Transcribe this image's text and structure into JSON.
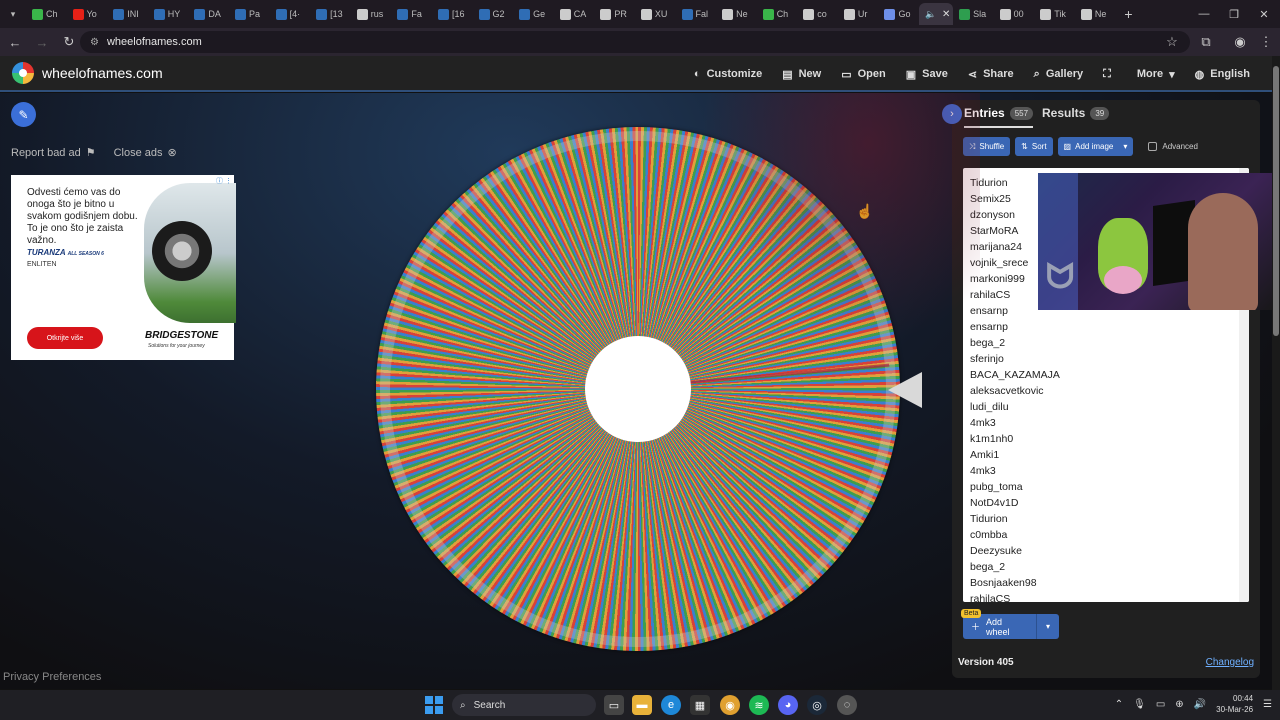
{
  "browser": {
    "tabs": [
      {
        "label": "Ch",
        "color": "#3ab54a"
      },
      {
        "label": "Yo",
        "color": "#e62117"
      },
      {
        "label": "INI",
        "color": "#2f6db5"
      },
      {
        "label": "HY",
        "color": "#2f6db5"
      },
      {
        "label": "DA",
        "color": "#2f6db5"
      },
      {
        "label": "Pa",
        "color": "#2f6db5"
      },
      {
        "label": "[4·",
        "color": "#2f6db5"
      },
      {
        "label": "[13",
        "color": "#2f6db5"
      },
      {
        "label": "rus",
        "color": "#cccccc"
      },
      {
        "label": "Fa",
        "color": "#2f6db5"
      },
      {
        "label": "[16",
        "color": "#2f6db5"
      },
      {
        "label": "G2",
        "color": "#2f6db5"
      },
      {
        "label": "Ge",
        "color": "#2f6db5"
      },
      {
        "label": "CA",
        "color": "#cccccc"
      },
      {
        "label": "PR",
        "color": "#cccccc"
      },
      {
        "label": "XU",
        "color": "#cccccc"
      },
      {
        "label": "Fal",
        "color": "#2f6db5"
      },
      {
        "label": "Ne",
        "color": "#cccccc"
      },
      {
        "label": "Ch",
        "color": "#3ab54a"
      },
      {
        "label": "co",
        "color": "#cccccc"
      },
      {
        "label": "Ur",
        "color": "#cccccc"
      },
      {
        "label": "Go",
        "color": "#6e8fe8"
      }
    ],
    "active_tab_icon": "speaker-icon",
    "tabs_after": [
      {
        "label": "Sla",
        "color": "#2e9e4f"
      },
      {
        "label": "00",
        "color": "#cccccc"
      },
      {
        "label": "Tik",
        "color": "#cccccc"
      },
      {
        "label": "Ne",
        "color": "#cccccc"
      }
    ],
    "url": "wheelofnames.com"
  },
  "site": {
    "name": "wheelofnames.com",
    "menu": [
      {
        "label": "Customize",
        "icon": "palette-icon",
        "glyph": "◐"
      },
      {
        "label": "New",
        "icon": "file-icon",
        "glyph": "▤"
      },
      {
        "label": "Open",
        "icon": "folder-icon",
        "glyph": "▭"
      },
      {
        "label": "Save",
        "icon": "save-icon",
        "glyph": "▣"
      },
      {
        "label": "Share",
        "icon": "share-icon",
        "glyph": "⋖"
      },
      {
        "label": "Gallery",
        "icon": "search-icon",
        "glyph": "⌕"
      },
      {
        "label": "",
        "icon": "fullscreen-icon",
        "glyph": "⛶"
      },
      {
        "label": "More",
        "icon": "chevron-down-icon",
        "glyph": "▾"
      },
      {
        "label": "English",
        "icon": "globe-icon",
        "glyph": "◍"
      }
    ]
  },
  "ad_links": {
    "report": "Report bad ad",
    "close": "Close ads"
  },
  "ad": {
    "text": "Odvesti ćemo vas do onoga što je bitno u svakom godišnjem dobu. To je ono što je zaista važno.",
    "brand": "TURANZA",
    "brand_sub": "ALL SEASON 6",
    "series": "ENLITEN",
    "cta": "Otkrijte više",
    "logo": "BRIDGESTONE",
    "logo_sub": "Solutions for your journey"
  },
  "panel": {
    "entries_label": "Entries",
    "entries_count": "557",
    "results_label": "Results",
    "results_count": "39",
    "shuffle": "Shuffle",
    "sort": "Sort",
    "add_image": "Add image",
    "advanced": "Advanced",
    "entries": [
      "Tidurion",
      "Semix25",
      "dzonyson",
      "StarMoRA",
      "marijana24",
      "vojnik_srece",
      "markoni999",
      "rahilaCS",
      "ensarnp",
      "ensarnp",
      "bega_2",
      "sferinjo",
      "BACA_KAZAMAJA",
      "aleksacvetkovic",
      "ludi_dilu",
      "4mk3",
      "k1m1nh0",
      "Amki1",
      "4mk3",
      "pubg_toma",
      "NotD4v1D",
      "Tidurion",
      "c0mbba",
      "Deezysuke",
      "bega_2",
      "Bosnjaaken98",
      "rahilaCS"
    ],
    "beta": "Beta",
    "add_wheel": "Add wheel",
    "version": "Version 405",
    "changelog": "Changelog"
  },
  "footer": {
    "privacy": "Privacy Preferences"
  },
  "taskbar": {
    "search": "Search",
    "time": "00:44",
    "date": "30-Mar-26"
  }
}
